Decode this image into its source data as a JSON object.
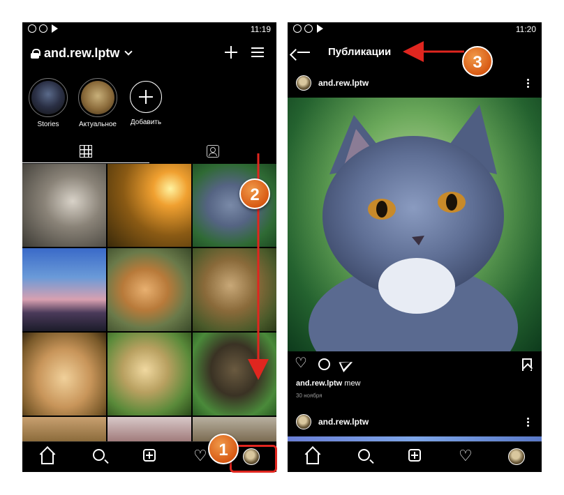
{
  "colors": {
    "background": "#000000",
    "accent_red": "#e0261f",
    "badge_orange": "#e06a1e",
    "muted_text": "#9a9a9a"
  },
  "left_screen": {
    "status_time": "11:19",
    "username": "and.rew.lptw",
    "highlights": [
      {
        "label": "Stories"
      },
      {
        "label": "Актуальное"
      },
      {
        "label": "Добавить"
      }
    ],
    "tabs": [
      {
        "icon": "grid-icon",
        "active": true
      },
      {
        "icon": "tagged-icon",
        "active": false
      }
    ],
    "bottom_nav": [
      "home-icon",
      "search-icon",
      "new-post-icon",
      "heart-icon",
      "profile-avatar"
    ]
  },
  "right_screen": {
    "status_time": "11:20",
    "title": "Публикации",
    "post": {
      "author": "and.rew.lptw",
      "caption_user": "and.rew.lptw",
      "caption_text": "mew",
      "date": "30 ноября"
    },
    "next_post_author": "and.rew.lptw",
    "bottom_nav": [
      "home-icon",
      "search-icon",
      "new-post-icon",
      "heart-icon",
      "profile-avatar"
    ]
  },
  "annotations": [
    {
      "number": "1"
    },
    {
      "number": "2"
    },
    {
      "number": "3"
    }
  ]
}
